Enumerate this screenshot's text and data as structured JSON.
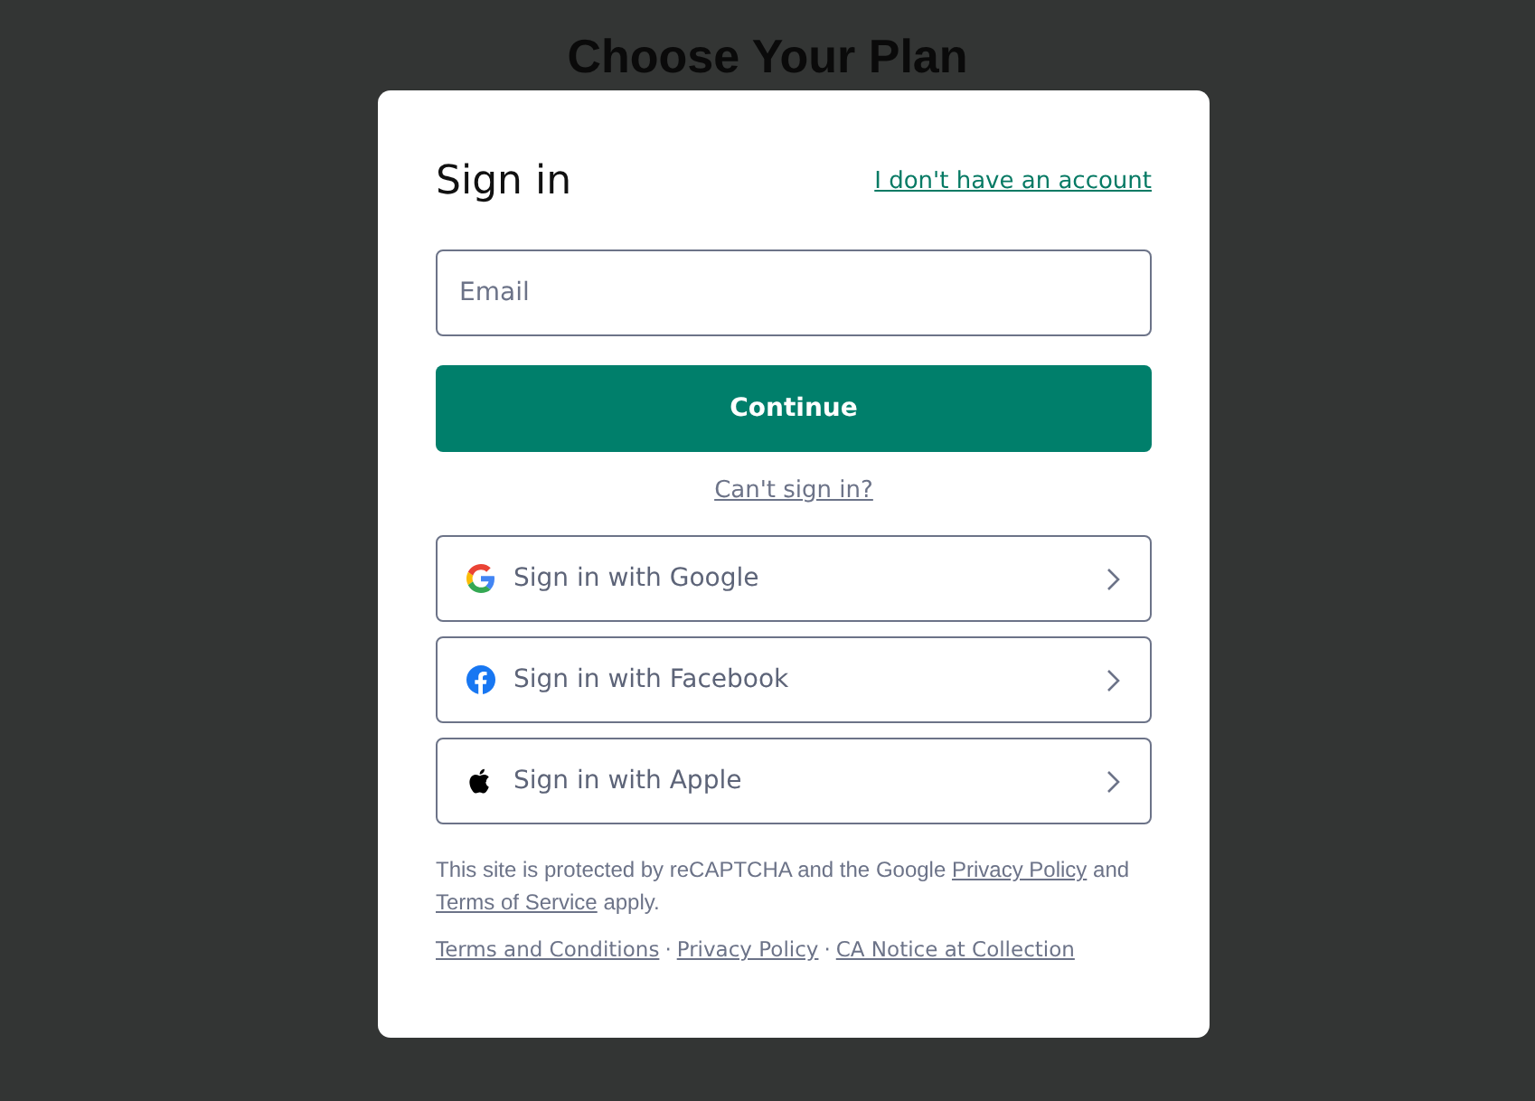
{
  "background": {
    "heading": "Choose Your Plan"
  },
  "dialog": {
    "title": "Sign in",
    "signup_link": "I don't have an account",
    "email": {
      "placeholder": "Email"
    },
    "continue_button": "Continue",
    "cant_sign_in_link": "Can't sign in?",
    "providers": [
      {
        "kind": "google",
        "label": "Sign in with Google"
      },
      {
        "kind": "facebook",
        "label": "Sign in with Facebook"
      },
      {
        "kind": "apple",
        "label": "Sign in with Apple"
      }
    ],
    "recaptcha": {
      "before": "This site is protected by reCAPTCHA and the Google",
      "privacy_link": "Privacy Policy",
      "middle": "and",
      "terms_link": "Terms of Service",
      "after": "apply."
    },
    "footer_links": [
      "Terms and Conditions",
      "Privacy Policy",
      "CA Notice at Collection"
    ],
    "separator": "·"
  }
}
